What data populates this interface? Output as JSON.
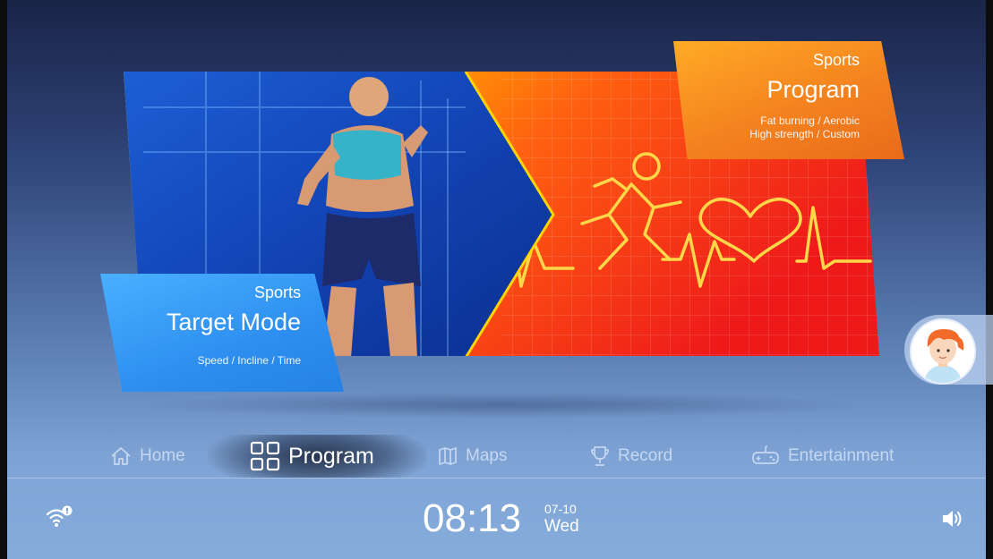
{
  "banner": {
    "program_card": {
      "kicker": "Sports",
      "title": "Program",
      "subtitle_line1": "Fat burning / Aerobic",
      "subtitle_line2": "High strength / Custom"
    },
    "target_card": {
      "kicker": "Sports",
      "title": "Target Mode",
      "subtitle": "Speed / Incline / Time"
    }
  },
  "nav": {
    "items": [
      {
        "label": "Home",
        "icon": "home-icon",
        "active": false
      },
      {
        "label": "Program",
        "icon": "grid-icon",
        "active": true
      },
      {
        "label": "Maps",
        "icon": "map-icon",
        "active": false
      },
      {
        "label": "Record",
        "icon": "trophy-icon",
        "active": false
      },
      {
        "label": "Entertainment",
        "icon": "gamepad-icon",
        "active": false
      }
    ]
  },
  "status": {
    "time": "08:13",
    "date": "07-10",
    "weekday": "Wed",
    "wifi_icon": "wifi-alert-icon",
    "volume_icon": "volume-icon"
  },
  "colors": {
    "accent_orange": "#f4821f",
    "accent_blue": "#2e8ff0"
  }
}
